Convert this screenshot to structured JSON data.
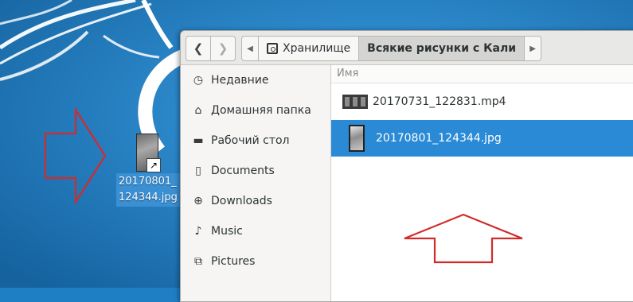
{
  "desktop": {
    "icon_label_line1": "20170801_",
    "icon_label_line2": "124344.jpg",
    "colors": {
      "background": "#1f7fc4",
      "annotation_arrow": "#d22b2b"
    }
  },
  "toolbar": {
    "back_icon": "chevron-left-icon",
    "forward_icon": "chevron-right-icon",
    "path": [
      {
        "label": "Хранилище",
        "icon": "drive-icon"
      },
      {
        "label": "Всякие рисунки с Кали",
        "active": true
      }
    ]
  },
  "sidebar": {
    "items": [
      {
        "label": "Недавние",
        "icon": "clock-icon"
      },
      {
        "label": "Домашняя папка",
        "icon": "home-icon"
      },
      {
        "label": "Рабочий стол",
        "icon": "folder-icon"
      },
      {
        "label": "Documents",
        "icon": "document-icon"
      },
      {
        "label": "Downloads",
        "icon": "download-icon"
      },
      {
        "label": "Music",
        "icon": "music-icon"
      },
      {
        "label": "Pictures",
        "icon": "pictures-icon"
      }
    ]
  },
  "main": {
    "column_header": "Имя",
    "files": [
      {
        "name": "20170731_122831.mp4",
        "type": "video",
        "selected": false
      },
      {
        "name": "20170801_124344.jpg",
        "type": "image",
        "selected": true
      }
    ],
    "colors": {
      "selection": "#2a8ad5"
    }
  }
}
